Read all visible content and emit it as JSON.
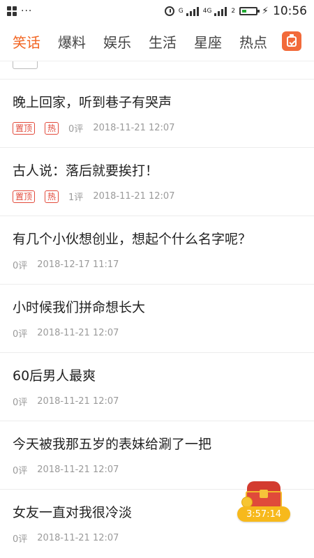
{
  "status_bar": {
    "dots": "···",
    "network_1": "G",
    "network_2": "4G",
    "sim_2": "2",
    "time": "10:56"
  },
  "tabs": [
    {
      "label": "笑话",
      "active": true
    },
    {
      "label": "爆料",
      "active": false
    },
    {
      "label": "娱乐",
      "active": false
    },
    {
      "label": "生活",
      "active": false
    },
    {
      "label": "星座",
      "active": false
    },
    {
      "label": "热点",
      "active": false
    }
  ],
  "tab_action_icon": "clipboard-icon",
  "articles": [
    {
      "title": "晚上回家，听到巷子有哭声",
      "badges": [
        "置顶",
        "热"
      ],
      "comments": "0评",
      "date": "2018-11-21 12:07"
    },
    {
      "title": "古人说：落后就要挨打！",
      "badges": [
        "置顶",
        "热"
      ],
      "comments": "1评",
      "date": "2018-11-21 12:07"
    },
    {
      "title": "有几个小伙想创业，想起个什么名字呢？",
      "badges": [],
      "comments": "0评",
      "date": "2018-12-17 11:17"
    },
    {
      "title": "小时候我们拼命想长大",
      "badges": [],
      "comments": "0评",
      "date": "2018-11-21 12:07"
    },
    {
      "title": "60后男人最爽",
      "badges": [],
      "comments": "0评",
      "date": "2018-11-21 12:07"
    },
    {
      "title": "今天被我那五岁的表妹给涮了一把",
      "badges": [],
      "comments": "0评",
      "date": "2018-11-21 12:07"
    },
    {
      "title": "女友一直对我很冷淡",
      "badges": [],
      "comments": "0评",
      "date": "2018-11-21 12:07"
    }
  ],
  "reward": {
    "timer": "3:57:14",
    "icon": "treasure-chest-icon"
  },
  "colors": {
    "accent": "#f26522",
    "badge": "#e24a3b",
    "meta": "#9a9a9a",
    "timer_bg": "#f7b91c"
  }
}
